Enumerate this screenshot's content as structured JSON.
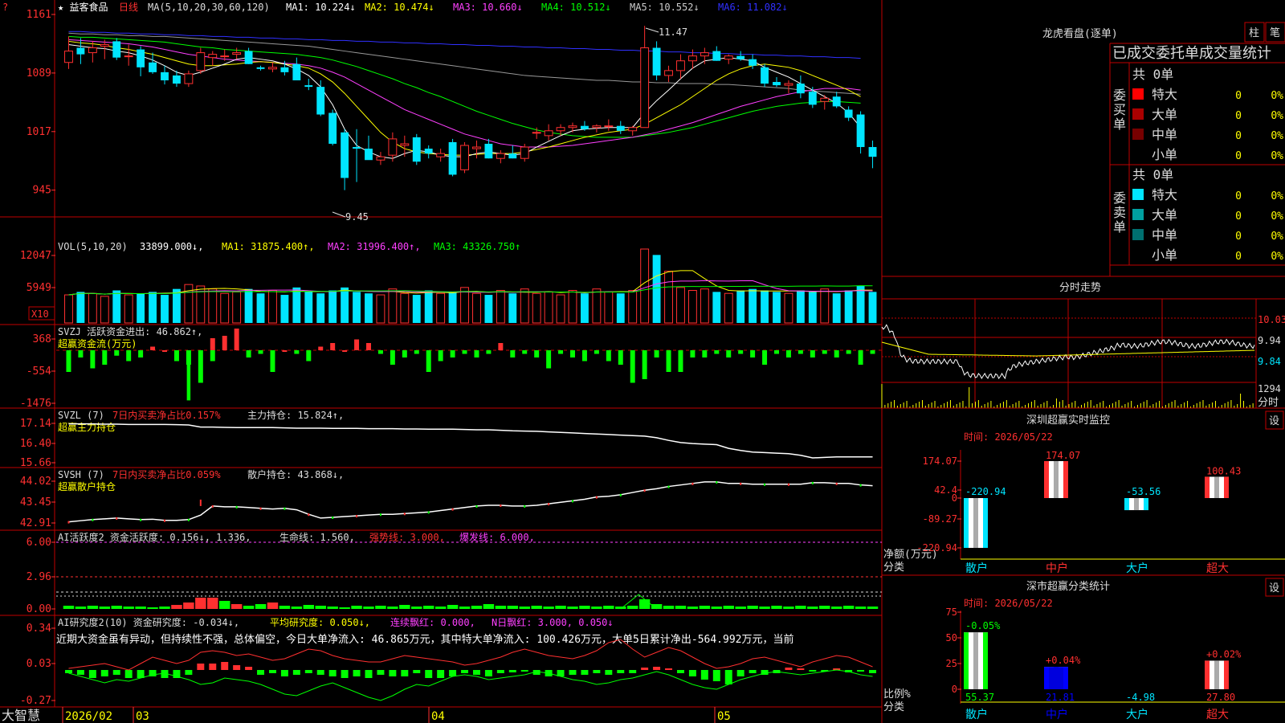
{
  "colors": {
    "up": "#ff3030",
    "down": "#00e5ff",
    "green": "#00ff00",
    "yellow": "#ffff00",
    "magenta": "#ff40ff",
    "grid": "#c00000",
    "text": "#dddddd",
    "white": "#ffffff",
    "blue": "#3030ff",
    "gray": "#999999"
  },
  "top_left_marker": "?",
  "stock": {
    "name": "★ 益客食品",
    "period": "日线"
  },
  "main_chart": {
    "ma_header": "MA(5,10,20,30,60,120)",
    "ma": [
      {
        "label": "MA1: 10.224↓",
        "color": "#ffffff"
      },
      {
        "label": "MA2: 10.474↓",
        "color": "#ffff00"
      },
      {
        "label": "MA3: 10.660↓",
        "color": "#ff40ff"
      },
      {
        "label": "MA4: 10.512↓",
        "color": "#00ff00"
      },
      {
        "label": "MA5: 10.552↓",
        "color": "#cccccc"
      },
      {
        "label": "MA6: 11.082↓",
        "color": "#3030ff"
      }
    ],
    "y_ticks": [
      "1161",
      "1089",
      "1017",
      "945"
    ],
    "high_label": "11.47",
    "low_label": "9.45"
  },
  "candles": [
    {
      "o": 11.02,
      "h": 11.34,
      "l": 10.94,
      "c": 11.16
    },
    {
      "o": 11.2,
      "h": 11.32,
      "l": 11.0,
      "c": 11.12
    },
    {
      "o": 11.14,
      "h": 11.28,
      "l": 11.02,
      "c": 11.2
    },
    {
      "o": 11.22,
      "h": 11.3,
      "l": 11.06,
      "c": 11.24
    },
    {
      "o": 11.28,
      "h": 11.32,
      "l": 11.05,
      "c": 11.08
    },
    {
      "o": 11.1,
      "h": 11.24,
      "l": 10.98,
      "c": 11.1
    },
    {
      "o": 11.18,
      "h": 11.22,
      "l": 10.85,
      "c": 10.96
    },
    {
      "o": 11.02,
      "h": 11.14,
      "l": 10.88,
      "c": 10.9
    },
    {
      "o": 10.9,
      "h": 10.98,
      "l": 10.75,
      "c": 10.8
    },
    {
      "o": 10.86,
      "h": 10.92,
      "l": 10.72,
      "c": 10.76
    },
    {
      "o": 10.76,
      "h": 10.92,
      "l": 10.72,
      "c": 10.88
    },
    {
      "o": 10.92,
      "h": 11.2,
      "l": 10.88,
      "c": 11.14
    },
    {
      "o": 11.08,
      "h": 11.16,
      "l": 10.98,
      "c": 11.12
    },
    {
      "o": 11.1,
      "h": 11.18,
      "l": 11.04,
      "c": 11.1
    },
    {
      "o": 11.12,
      "h": 11.2,
      "l": 11.06,
      "c": 11.14
    },
    {
      "o": 11.16,
      "h": 11.2,
      "l": 11.0,
      "c": 11.0
    },
    {
      "o": 10.96,
      "h": 10.98,
      "l": 10.92,
      "c": 10.94
    },
    {
      "o": 10.94,
      "h": 11.02,
      "l": 10.9,
      "c": 10.96
    },
    {
      "o": 10.96,
      "h": 11.04,
      "l": 10.86,
      "c": 10.9
    },
    {
      "o": 11.0,
      "h": 11.08,
      "l": 10.86,
      "c": 10.8
    },
    {
      "o": 10.74,
      "h": 10.82,
      "l": 10.68,
      "c": 10.72
    },
    {
      "o": 10.72,
      "h": 10.8,
      "l": 10.36,
      "c": 10.38
    },
    {
      "o": 10.4,
      "h": 10.44,
      "l": 10.0,
      "c": 10.02
    },
    {
      "o": 10.16,
      "h": 10.2,
      "l": 9.45,
      "c": 9.6
    },
    {
      "o": 9.98,
      "h": 10.2,
      "l": 9.55,
      "c": 9.96
    },
    {
      "o": 9.96,
      "h": 10.12,
      "l": 9.84,
      "c": 9.82
    },
    {
      "o": 9.82,
      "h": 9.92,
      "l": 9.76,
      "c": 9.86
    },
    {
      "o": 9.88,
      "h": 10.16,
      "l": 9.8,
      "c": 10.08
    },
    {
      "o": 10.0,
      "h": 10.12,
      "l": 9.86,
      "c": 10.02
    },
    {
      "o": 10.1,
      "h": 10.14,
      "l": 9.76,
      "c": 9.8
    },
    {
      "o": 9.96,
      "h": 10.0,
      "l": 9.84,
      "c": 9.9
    },
    {
      "o": 9.86,
      "h": 9.96,
      "l": 9.8,
      "c": 9.9
    },
    {
      "o": 10.04,
      "h": 10.08,
      "l": 9.62,
      "c": 9.64
    },
    {
      "o": 9.7,
      "h": 10.04,
      "l": 9.66,
      "c": 10.0
    },
    {
      "o": 9.96,
      "h": 10.06,
      "l": 9.84,
      "c": 9.98
    },
    {
      "o": 10.02,
      "h": 10.08,
      "l": 9.84,
      "c": 9.84
    },
    {
      "o": 9.84,
      "h": 9.94,
      "l": 9.78,
      "c": 9.9
    },
    {
      "o": 9.9,
      "h": 10.0,
      "l": 9.84,
      "c": 9.84
    },
    {
      "o": 9.84,
      "h": 10.02,
      "l": 9.8,
      "c": 9.98
    },
    {
      "o": 10.16,
      "h": 10.22,
      "l": 10.08,
      "c": 10.16
    },
    {
      "o": 10.12,
      "h": 10.26,
      "l": 10.06,
      "c": 10.18
    },
    {
      "o": 10.18,
      "h": 10.26,
      "l": 10.12,
      "c": 10.22
    },
    {
      "o": 10.22,
      "h": 10.28,
      "l": 10.16,
      "c": 10.24
    },
    {
      "o": 10.24,
      "h": 10.3,
      "l": 10.18,
      "c": 10.2
    },
    {
      "o": 10.22,
      "h": 10.26,
      "l": 10.16,
      "c": 10.24
    },
    {
      "o": 10.24,
      "h": 10.32,
      "l": 10.18,
      "c": 10.24
    },
    {
      "o": 10.24,
      "h": 10.3,
      "l": 10.14,
      "c": 10.18
    },
    {
      "o": 10.18,
      "h": 10.24,
      "l": 10.12,
      "c": 10.22
    },
    {
      "o": 10.22,
      "h": 11.47,
      "l": 10.88,
      "c": 11.2
    },
    {
      "o": 11.2,
      "h": 11.28,
      "l": 10.8,
      "c": 10.86
    },
    {
      "o": 10.86,
      "h": 10.98,
      "l": 10.78,
      "c": 10.92
    },
    {
      "o": 10.92,
      "h": 11.12,
      "l": 10.82,
      "c": 11.04
    },
    {
      "o": 11.04,
      "h": 11.18,
      "l": 10.94,
      "c": 11.1
    },
    {
      "o": 11.1,
      "h": 11.2,
      "l": 11.0,
      "c": 11.14
    },
    {
      "o": 11.16,
      "h": 11.22,
      "l": 11.04,
      "c": 11.04
    },
    {
      "o": 11.06,
      "h": 11.12,
      "l": 11.0,
      "c": 11.1
    },
    {
      "o": 11.1,
      "h": 11.16,
      "l": 11.04,
      "c": 11.06
    },
    {
      "o": 11.06,
      "h": 11.12,
      "l": 10.94,
      "c": 10.98
    },
    {
      "o": 10.96,
      "h": 11.0,
      "l": 10.72,
      "c": 10.76
    },
    {
      "o": 10.78,
      "h": 10.84,
      "l": 10.72,
      "c": 10.74
    },
    {
      "o": 10.74,
      "h": 10.8,
      "l": 10.64,
      "c": 10.76
    },
    {
      "o": 10.76,
      "h": 10.86,
      "l": 10.58,
      "c": 10.64
    },
    {
      "o": 10.66,
      "h": 10.72,
      "l": 10.46,
      "c": 10.5
    },
    {
      "o": 10.54,
      "h": 10.62,
      "l": 10.44,
      "c": 10.58
    },
    {
      "o": 10.6,
      "h": 10.66,
      "l": 10.46,
      "c": 10.48
    },
    {
      "o": 10.44,
      "h": 10.48,
      "l": 10.3,
      "c": 10.34
    },
    {
      "o": 10.38,
      "h": 10.42,
      "l": 9.9,
      "c": 9.98
    },
    {
      "o": 9.98,
      "h": 10.06,
      "l": 9.72,
      "c": 9.86
    }
  ],
  "ma_lines": {
    "ma5": [
      11.24,
      11.22,
      11.2,
      11.19,
      11.16,
      11.14,
      11.1,
      11.05,
      10.98,
      10.9,
      10.86,
      10.9,
      10.95,
      11.0,
      11.06,
      11.08,
      11.06,
      11.04,
      11.0,
      10.94,
      10.86,
      10.72,
      10.5,
      10.2,
      10.0,
      9.92,
      9.86,
      9.84,
      9.9,
      9.94,
      9.92,
      9.88,
      9.86,
      9.86,
      9.9,
      9.92,
      9.9,
      9.88,
      9.9,
      9.98,
      10.05,
      10.12,
      10.18,
      10.2,
      10.21,
      10.22,
      10.22,
      10.22,
      10.4,
      10.55,
      10.68,
      10.82,
      10.95,
      11.04,
      11.06,
      11.08,
      11.06,
      11.04,
      10.96,
      10.9,
      10.84,
      10.76,
      10.68,
      10.6,
      10.52,
      10.4,
      10.22
    ],
    "ma10": [
      11.28,
      11.26,
      11.25,
      11.23,
      11.2,
      11.18,
      11.15,
      11.12,
      11.08,
      11.04,
      11.0,
      10.98,
      10.98,
      10.99,
      11.0,
      11.02,
      11.03,
      11.02,
      11.0,
      10.98,
      10.95,
      10.88,
      10.78,
      10.64,
      10.48,
      10.32,
      10.16,
      10.04,
      9.96,
      9.92,
      9.9,
      9.89,
      9.88,
      9.88,
      9.89,
      9.9,
      9.9,
      9.9,
      9.92,
      9.95,
      9.98,
      10.02,
      10.06,
      10.1,
      10.13,
      10.16,
      10.18,
      10.2,
      10.26,
      10.34,
      10.42,
      10.5,
      10.6,
      10.7,
      10.8,
      10.88,
      10.94,
      10.98,
      11.0,
      10.98,
      10.96,
      10.92,
      10.86,
      10.8,
      10.74,
      10.68,
      10.6
    ],
    "ma20": [
      11.3,
      11.29,
      11.28,
      11.27,
      11.26,
      11.25,
      11.23,
      11.21,
      11.18,
      11.15,
      11.12,
      11.1,
      11.08,
      11.06,
      11.05,
      11.04,
      11.03,
      11.02,
      11.01,
      11.0,
      10.98,
      10.95,
      10.9,
      10.84,
      10.76,
      10.68,
      10.6,
      10.52,
      10.44,
      10.38,
      10.32,
      10.26,
      10.2,
      10.14,
      10.1,
      10.06,
      10.02,
      10.0,
      9.98,
      9.98,
      9.98,
      9.99,
      10.0,
      10.02,
      10.04,
      10.06,
      10.08,
      10.1,
      10.13,
      10.16,
      10.2,
      10.24,
      10.28,
      10.33,
      10.38,
      10.43,
      10.48,
      10.52,
      10.56,
      10.6,
      10.63,
      10.66,
      10.68,
      10.7,
      10.7,
      10.7,
      10.68
    ],
    "ma30": [
      11.34,
      11.33,
      11.33,
      11.32,
      11.31,
      11.3,
      11.29,
      11.28,
      11.27,
      11.25,
      11.23,
      11.21,
      11.2,
      11.18,
      11.17,
      11.16,
      11.15,
      11.14,
      11.13,
      11.12,
      11.1,
      11.08,
      11.05,
      11.01,
      10.97,
      10.92,
      10.87,
      10.82,
      10.76,
      10.71,
      10.65,
      10.6,
      10.54,
      10.48,
      10.42,
      10.37,
      10.32,
      10.27,
      10.23,
      10.19,
      10.16,
      10.14,
      10.12,
      10.11,
      10.1,
      10.1,
      10.1,
      10.1,
      10.12,
      10.14,
      10.16,
      10.19,
      10.22,
      10.26,
      10.3,
      10.34,
      10.38,
      10.42,
      10.45,
      10.48,
      10.5,
      10.52,
      10.53,
      10.54,
      10.54,
      10.53,
      10.52
    ],
    "ma60": [
      11.38,
      11.37,
      11.37,
      11.36,
      11.36,
      11.35,
      11.35,
      11.34,
      11.34,
      11.33,
      11.32,
      11.31,
      11.3,
      11.29,
      11.28,
      11.27,
      11.26,
      11.25,
      11.24,
      11.23,
      11.22,
      11.2,
      11.18,
      11.16,
      11.14,
      11.12,
      11.1,
      11.08,
      11.06,
      11.04,
      11.02,
      11.0,
      10.98,
      10.96,
      10.94,
      10.92,
      10.9,
      10.88,
      10.86,
      10.85,
      10.84,
      10.83,
      10.82,
      10.81,
      10.8,
      10.8,
      10.79,
      10.78,
      10.78,
      10.77,
      10.77,
      10.76,
      10.76,
      10.76,
      10.75,
      10.75,
      10.74,
      10.73,
      10.72,
      10.71,
      10.7,
      10.68,
      10.67,
      10.66,
      10.65,
      10.64,
      10.63
    ],
    "ma120": [
      11.4,
      11.4,
      11.39,
      11.39,
      11.38,
      11.38,
      11.37,
      11.37,
      11.36,
      11.36,
      11.35,
      11.35,
      11.34,
      11.34,
      11.33,
      11.33,
      11.32,
      11.32,
      11.31,
      11.31,
      11.3,
      11.3,
      11.29,
      11.29,
      11.28,
      11.28,
      11.27,
      11.27,
      11.26,
      11.26,
      11.25,
      11.25,
      11.24,
      11.24,
      11.23,
      11.23,
      11.22,
      11.22,
      11.21,
      11.21,
      11.2,
      11.2,
      11.19,
      11.19,
      11.18,
      11.18,
      11.17,
      11.17,
      11.16,
      11.16,
      11.15,
      11.15,
      11.14,
      11.14,
      11.13,
      11.13,
      11.12,
      11.12,
      11.11,
      11.11,
      11.1,
      11.1,
      11.09,
      11.09,
      11.08,
      11.08,
      11.07
    ]
  },
  "volume": {
    "header": "VOL(5,10,20)",
    "vol_label": "33899.000↓,",
    "ma": [
      {
        "label": "MA1: 31875.400↑,",
        "color": "#ffff00"
      },
      {
        "label": "MA2: 31996.400↑,",
        "color": "#ff40ff"
      },
      {
        "label": "MA3: 43326.750↑",
        "color": "#00ff00"
      }
    ],
    "y_ticks": [
      "12047",
      "5949"
    ],
    "unit": "X10",
    "bars": [
      38,
      42,
      40,
      36,
      44,
      38,
      40,
      42,
      38,
      46,
      52,
      50,
      46,
      40,
      42,
      46,
      40,
      44,
      38,
      48,
      42,
      40,
      44,
      48,
      42,
      40,
      38,
      46,
      40,
      38,
      44,
      40,
      42,
      48,
      40,
      38,
      44,
      40,
      46,
      40,
      42,
      38,
      44,
      40,
      46,
      42,
      40,
      44,
      100,
      92,
      70,
      48,
      44,
      46,
      42,
      40,
      44,
      46,
      44,
      42,
      40,
      44,
      42,
      46,
      40,
      44,
      50,
      42
    ]
  },
  "svzj": {
    "header": "SVZJ  活跃资金进出: 46.862↑,",
    "sub": "超赢资金流(万元)",
    "y_ticks": [
      "368",
      "-554",
      "-1476"
    ],
    "bars": [
      -60,
      -20,
      -50,
      -40,
      -15,
      -30,
      -20,
      10,
      0,
      -30,
      -40,
      -90,
      -30,
      40,
      60,
      -20,
      -10,
      -60,
      0,
      -10,
      -30,
      10,
      20,
      0,
      30,
      20,
      -10,
      -40,
      -20,
      -10,
      -60,
      -30,
      -20,
      -10,
      -20,
      -10,
      20,
      -20,
      -10,
      -20,
      -50,
      -10,
      -20,
      -30,
      -10,
      -30,
      -40,
      -90,
      -80,
      -20,
      -60,
      -60,
      -20,
      -20,
      -10,
      -20,
      -10,
      -20,
      -40,
      -10,
      -20,
      -10,
      -20,
      -10,
      -20,
      -10,
      -40,
      -10
    ],
    "bars2": [
      0,
      0,
      0,
      0,
      0,
      0,
      0,
      0,
      0,
      0,
      -480,
      0,
      0,
      0,
      0,
      0,
      0,
      0,
      0,
      0,
      0,
      0,
      0,
      0,
      0,
      0,
      0,
      0,
      0,
      0,
      0,
      0,
      0,
      0,
      0,
      0,
      0,
      0,
      0,
      0,
      0,
      0,
      0,
      0,
      0,
      0,
      0,
      0,
      0,
      0,
      0,
      0,
      0,
      0,
      0,
      0,
      0,
      0,
      0,
      0,
      0,
      0,
      0,
      0,
      0,
      0,
      0,
      0
    ]
  },
  "svzl": {
    "header": "SVZL (7)",
    "ratio": "7日内买卖净占比0.157%",
    "hold": "主力持仓: 15.824↑,",
    "sub": "超赢主力持仓",
    "y_ticks": [
      "17.14",
      "16.40",
      "15.66"
    ],
    "line": [
      17.12,
      17.12,
      17.12,
      17.11,
      17.11,
      17.1,
      17.1,
      17.1,
      17.1,
      17.09,
      17.08,
      17.0,
      17.0,
      16.99,
      16.98,
      16.98,
      16.98,
      16.98,
      16.97,
      16.96,
      16.96,
      16.96,
      16.95,
      16.95,
      16.95,
      16.94,
      16.94,
      16.94,
      16.93,
      16.93,
      16.92,
      16.92,
      16.92,
      16.91,
      16.9,
      16.9,
      16.88,
      16.86,
      16.85,
      16.84,
      16.82,
      16.8,
      16.78,
      16.76,
      16.74,
      16.72,
      16.7,
      16.68,
      16.66,
      16.6,
      16.5,
      16.42,
      16.38,
      16.36,
      16.34,
      16.2,
      16.12,
      16.06,
      16.04,
      16.02,
      16.0,
      15.94,
      15.84,
      15.86,
      15.88,
      15.88,
      15.88,
      15.88
    ]
  },
  "svsh": {
    "header": "SVSH (7)",
    "ratio": "7日内买卖净占比0.059%",
    "hold": "散户持仓: 43.868↓,",
    "sub": "超赢散户持仓",
    "y_ticks": [
      "44.02",
      "43.45",
      "42.91"
    ],
    "line": [
      42.94,
      42.97,
      43.0,
      43.02,
      43.04,
      43.02,
      43.0,
      43.01,
      42.98,
      42.98,
      43.0,
      43.12,
      43.36,
      43.34,
      43.34,
      43.32,
      43.3,
      43.28,
      43.3,
      43.26,
      43.14,
      43.04,
      43.06,
      43.08,
      43.1,
      43.12,
      43.14,
      43.14,
      43.16,
      43.18,
      43.2,
      43.24,
      43.28,
      43.32,
      43.36,
      43.38,
      43.38,
      43.36,
      43.36,
      43.38,
      43.42,
      43.46,
      43.5,
      43.54,
      43.6,
      43.62,
      43.66,
      43.72,
      43.78,
      43.82,
      43.88,
      43.92,
      43.96,
      44.0,
      44.0,
      43.96,
      43.96,
      43.94,
      43.94,
      43.94,
      43.94,
      43.94,
      43.98,
      43.98,
      43.96,
      43.96,
      43.92,
      43.9
    ]
  },
  "ai2": {
    "header": "AI活跃度2 资金活跃度: 0.156↓, 1.336,",
    "life": "生命线: 1.560,",
    "strong": "强势线: 3.000,",
    "burst": "爆发线: 6.000,",
    "y_ticks": [
      "6.00",
      "2.96",
      "0.00"
    ]
  },
  "ai_research": {
    "header": "AI研究度2(10) 资金研究度: -0.034↓,",
    "avg": "平均研究度: 0.050↓,",
    "lianxu": "连续飘红: 0.000,",
    "nri": "N日飘红: 3.000, 0.050↓",
    "commentary": "近期大资金虽有异动，但持续性不强，总体偏空，今日大单净流入: 46.865万元，其中特大单净流入: 100.426万元，大单5日累计净出-564.992万元，当前",
    "y_ticks": [
      "0.34",
      "0.03",
      "-0.27"
    ]
  },
  "x_axis": {
    "labels": [
      "2026/02",
      "03",
      "04",
      "05"
    ],
    "brand": "大智慧"
  },
  "dragon": {
    "title": "龙虎看盘(逐单)",
    "tabs": [
      "柱",
      "笔"
    ],
    "subtitle": "已成交委托单成交量统计",
    "buy_label": "委买单",
    "sell_label": "委卖单",
    "buy_total": "共 0单",
    "sell_total": "共 0单",
    "buy_rows": [
      {
        "name": "特大",
        "count": "0",
        "pct": "0%",
        "color": "#ff0000"
      },
      {
        "name": "大单",
        "count": "0",
        "pct": "0%",
        "color": "#aa0000"
      },
      {
        "name": "中单",
        "count": "0",
        "pct": "0%",
        "color": "#770000"
      },
      {
        "name": "小单",
        "count": "0",
        "pct": "0%",
        "color": ""
      }
    ],
    "sell_rows": [
      {
        "name": "特大",
        "count": "0",
        "pct": "0%",
        "color": "#00e5ff"
      },
      {
        "name": "大单",
        "count": "0",
        "pct": "0%",
        "color": "#00a0a0"
      },
      {
        "name": "中单",
        "count": "0",
        "pct": "0%",
        "color": "#007070"
      },
      {
        "name": "小单",
        "count": "0",
        "pct": "0%",
        "color": ""
      }
    ]
  },
  "intraday": {
    "title": "分时走势",
    "y_ticks": [
      "10.03",
      "9.94",
      "9.84"
    ],
    "vol_tick": "1294",
    "footer": "分时"
  },
  "sz_monitor": {
    "title": "深圳超赢实时监控",
    "settings": "设",
    "time": "时间: 2026/05/22",
    "y_ticks": [
      "174.07",
      "42.4",
      "0",
      "-89.27",
      "-220.94"
    ],
    "unit": "净额(万元)",
    "cat_label": "分类",
    "categories": [
      "散户",
      "中户",
      "大户",
      "超大"
    ],
    "values": [
      -220.94,
      174.07,
      -53.56,
      100.43
    ],
    "value_labels": [
      "-220.94",
      "174.07",
      "-53.56",
      "100.43"
    ]
  },
  "sz_class": {
    "title": "深市超赢分类统计",
    "settings": "设",
    "time": "时间: 2026/05/22",
    "y_ticks": [
      "75",
      "50",
      "25",
      "0"
    ],
    "unit": "比例%",
    "cat_label": "分类",
    "categories": [
      "散户",
      "中户",
      "大户",
      "超大"
    ],
    "values": [
      55.37,
      21.81,
      -4.98,
      27.8
    ],
    "value_labels": [
      "55.37",
      "21.81",
      "-4.98",
      "27.80"
    ],
    "top_labels": [
      "-0.05%",
      "+0.04%",
      "",
      "+0.02%"
    ]
  }
}
